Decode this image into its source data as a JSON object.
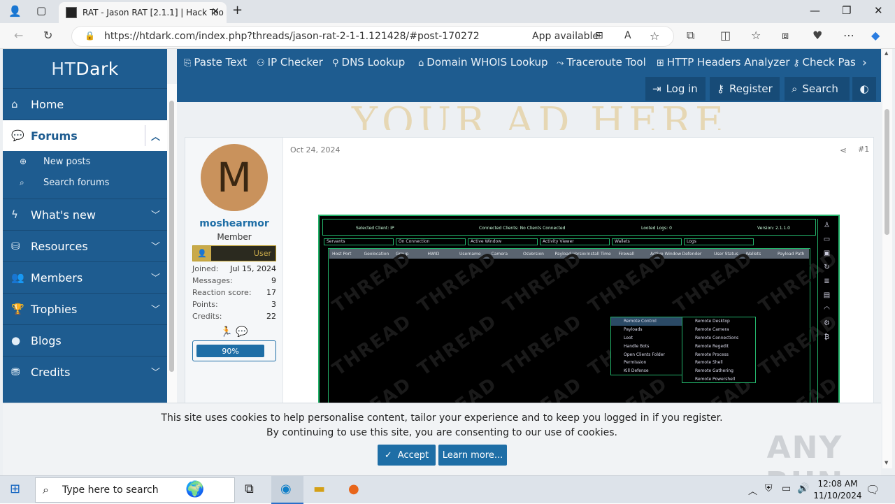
{
  "browser": {
    "tab_title": "RAT - Jason RAT [2.1.1] | Hack Too",
    "url": "https://htdark.com/index.php?threads/jason-rat-2-1-1.121428/#post-170272",
    "url_host": "htdark.com",
    "app_available": "App available"
  },
  "sidebar": {
    "logo_a": "HT",
    "logo_b": "Dark",
    "items": [
      {
        "label": "Home",
        "icon": "home-icon"
      },
      {
        "label": "Forums",
        "icon": "forums-icon"
      },
      {
        "label": "What's new",
        "icon": "bolt-icon"
      },
      {
        "label": "Resources",
        "icon": "resources-icon"
      },
      {
        "label": "Members",
        "icon": "members-icon"
      },
      {
        "label": "Trophies",
        "icon": "trophy-icon"
      },
      {
        "label": "Blogs",
        "icon": "blog-icon"
      },
      {
        "label": "Credits",
        "icon": "credits-icon"
      }
    ],
    "subitems": [
      "New posts",
      "Search forums"
    ]
  },
  "topnav": {
    "links": [
      "Paste Text",
      "IP Checker",
      "DNS Lookup",
      "Domain WHOIS Lookup",
      "Traceroute Tool",
      "HTTP Headers Analyzer",
      "Check Pas"
    ],
    "login": "Log in",
    "register": "Register",
    "search": "Search"
  },
  "ad_text": "YOUR AD HERE",
  "post": {
    "date": "Oct 24, 2024",
    "number": "#1",
    "user": {
      "avatar_letter": "M",
      "name": "moshearmor",
      "title": "Member",
      "banner": "User",
      "stats": [
        {
          "label": "Joined:",
          "value": "Jul 15, 2024"
        },
        {
          "label": "Messages:",
          "value": "9"
        },
        {
          "label": "Reaction score:",
          "value": "17"
        },
        {
          "label": "Points:",
          "value": "3"
        },
        {
          "label": "Credits:",
          "value": "22"
        }
      ],
      "progress_label": "90%",
      "progress_fraction": 0.9
    },
    "screenshot": {
      "selected_client": "Selected Client: IP",
      "connected_clients": "Connected Clients: No Clients Connected",
      "looted_logs": "Looted Logs: 0",
      "version": "Version: 2.1.1.0",
      "tabs": [
        "Servants",
        "On Connection",
        "Active Window",
        "Activity Viewer",
        "Wallets",
        "Logs"
      ],
      "columns": [
        "Host Port",
        "Geolocation",
        "Group",
        "HWID",
        "Username",
        "Camera",
        "OsVersion",
        "Payload Version",
        "Install Time",
        "Firewall",
        "Active Window",
        "Defender",
        "User Status",
        "Wallets",
        "Payload Path"
      ],
      "watermark": "THREAD",
      "menu": [
        "Remote Control",
        "Payloads",
        "Loot",
        "Handle Bots",
        "Open Clients Folder",
        "Permission",
        "Kill Defense"
      ],
      "submenu": [
        "Remote Desktop",
        "Remote Camera",
        "Remote Connections",
        "Remote Regedit",
        "Remote Process",
        "Remote Shell",
        "Remote Gathering",
        "Remote Powershell"
      ]
    }
  },
  "cookie": {
    "line1": "This site uses cookies to help personalise content, tailor your experience and to keep you logged in if you register.",
    "line2": "By continuing to use this site, you are consenting to our use of cookies.",
    "accept": "Accept",
    "learn_more": "Learn more..."
  },
  "watermark_logo": "ANY RUN",
  "taskbar": {
    "search_placeholder": "Type here to search",
    "time": "12:08 AM",
    "date": "11/10/2024"
  }
}
